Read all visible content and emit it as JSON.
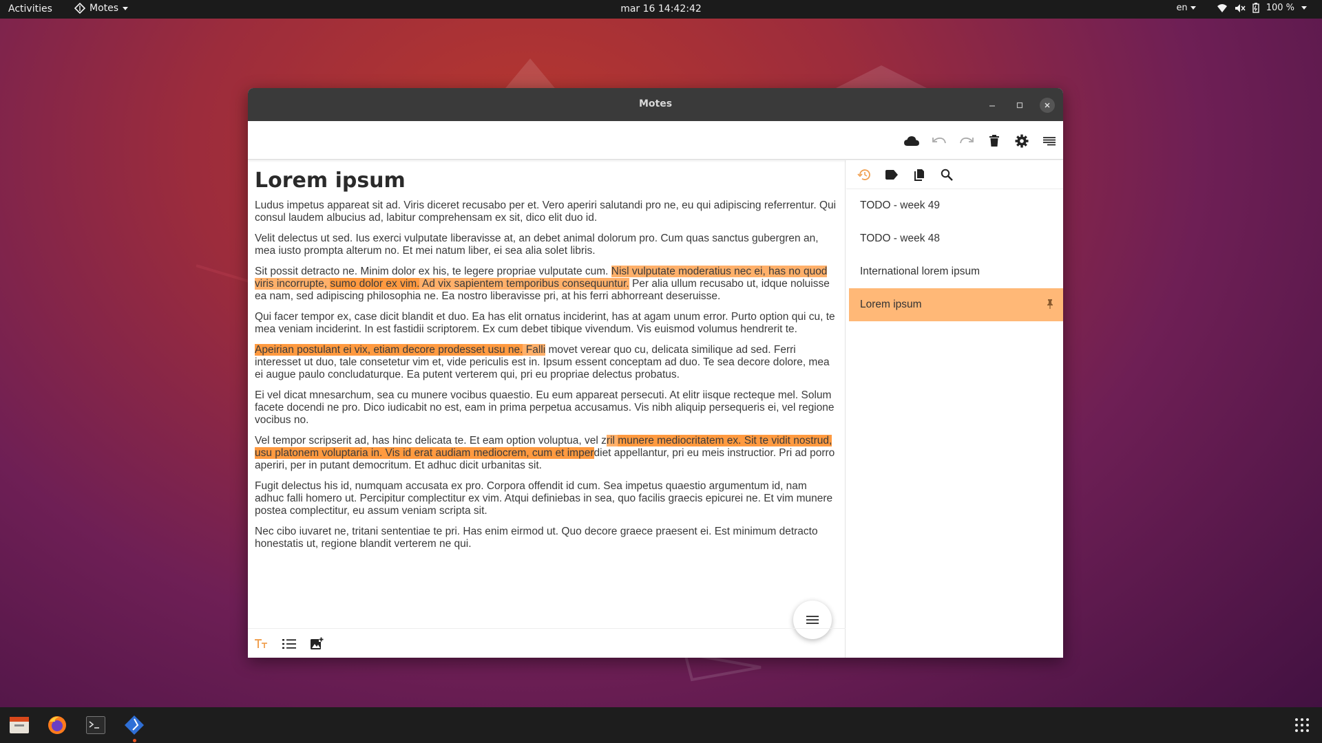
{
  "topbar": {
    "activities": "Activities",
    "app_name": "Motes",
    "clock": "mar 16  14:42:42",
    "language": "en",
    "battery": "100 %"
  },
  "window": {
    "title": "Motes"
  },
  "toolbar": {
    "icons": [
      "cloud-icon",
      "undo-icon",
      "redo-icon",
      "trash-icon",
      "gear-icon",
      "menu-icon"
    ]
  },
  "note": {
    "title": "Lorem ipsum",
    "paragraphs": [
      {
        "segments": [
          {
            "t": "Ludus impetus appareat sit ad. Viris diceret recusabo per et. Vero aperiri salutandi pro ne, eu qui adipiscing referrentur. Qui consul laudem albucius ad, labitur comprehensam ex sit, dico elit duo id.",
            "h": 0
          }
        ]
      },
      {
        "segments": [
          {
            "t": "Velit delectus ut sed. Ius exerci vulputate liberavisse at, an debet animal dolorum pro. Cum quas sanctus gubergren an, mea iusto prompta alterum no. Et mei natum liber, ei sea alia solet libris.",
            "h": 0
          }
        ]
      },
      {
        "segments": [
          {
            "t": "Sit possit detracto ne. Minim dolor ex his, te legere propriae vulputate cum. ",
            "h": 0
          },
          {
            "t": "Nisl vulputate moderatius nec ei, has no quod viris incorrupte, ",
            "h": 1
          },
          {
            "t": "sumo dolor ex vim.",
            "h": 2
          },
          {
            "t": " Ad vix sapientem temporibus consequuntur.",
            "h": 1
          },
          {
            "t": " Per alia ullum recusabo ut, idque noluisse ea nam, sed adipiscing philosophia ne. Ea nostro liberavisse pri, at his ferri abhorreant deseruisse.",
            "h": 0
          }
        ]
      },
      {
        "segments": [
          {
            "t": "Qui facer tempor ex, case dicit blandit et duo. Ea has elit ornatus inciderint, has at agam unum error. Purto option qui cu, te mea veniam inciderint. In est fastidii scriptorem. Ex cum debet tibique vivendum. Vis euismod volumus hendrerit te.",
            "h": 0
          }
        ]
      },
      {
        "segments": [
          {
            "t": "Apeirian postulant ei vix, etiam decore prodesset usu ne.",
            "h": 2
          },
          {
            "t": " Falli",
            "h": 1
          },
          {
            "t": " movet verear quo cu, delicata similique ad sed. Ferri interesset ut duo, tale consetetur vim et, vide periculis est in. Ipsum essent conceptam ad duo. Te sea decore dolore, mea ei augue paulo concludaturque. Ea putent verterem qui, pri eu propriae delectus probatus.",
            "h": 0
          }
        ]
      },
      {
        "segments": [
          {
            "t": "Ei vel dicat mnesarchum, sea cu munere vocibus quaestio. Eu eum appareat persecuti. At elitr iisque recteque mel. Solum facete docendi ne pro. Dico iudicabit no est, eam in prima perpetua accusamus. Vis nibh aliquip persequeris ei, vel regione vocibus no.",
            "h": 0
          }
        ]
      },
      {
        "segments": [
          {
            "t": "Vel tempor scripserit ad, has hinc delicata te. Et eam option voluptua, vel z",
            "h": 0
          },
          {
            "t": "ril ",
            "h": 1
          },
          {
            "t": "munere mediocritatem ex. Sit te vidit nostrud, usu platonem voluptaria in. Vis id erat audiam mediocrem, cum et imper",
            "h": 2
          },
          {
            "t": "diet appellantur, pri eu meis instructior. Pri ad porro aperiri, per in putant democritum. Et adhuc dicit urbanitas sit.",
            "h": 0
          }
        ]
      },
      {
        "segments": [
          {
            "t": "Fugit delectus his id, numquam accusata ex pro. Corpora offendit id cum. Sea impetus quaestio argumentum id, nam adhuc falli homero ut. Percipitur complectitur ex vim. Atqui definiebas in sea, quo facilis graecis epicurei ne. Et vim munere postea complectitur, eu assum veniam scripta sit.",
            "h": 0
          }
        ]
      },
      {
        "segments": [
          {
            "t": "Nec cibo iuvaret ne, tritani sententiae te pri. Has enim eirmod ut. Quo decore graece praesent ei. Est minimum detracto honestatis ut, regione blandit verterem ne qui.",
            "h": 0
          }
        ]
      }
    ]
  },
  "sidebar": {
    "tabs": [
      "history-icon",
      "tag-icon",
      "documents-icon",
      "search-icon"
    ],
    "notes": [
      {
        "label": "TODO - week 49",
        "active": false
      },
      {
        "label": "TODO - week 48",
        "active": false
      },
      {
        "label": "International lorem ipsum",
        "active": false
      },
      {
        "label": "Lorem ipsum",
        "active": true,
        "pinned": true
      }
    ]
  },
  "colors": {
    "accent": "#ffb877",
    "highlight_light": "#ffb06a",
    "highlight_dark": "#ff9a40",
    "history_tab": "#f0a050"
  },
  "dock": {
    "apps": [
      "files-icon",
      "firefox-icon",
      "terminal-icon",
      "motes-icon",
      "app-grid-icon"
    ]
  }
}
